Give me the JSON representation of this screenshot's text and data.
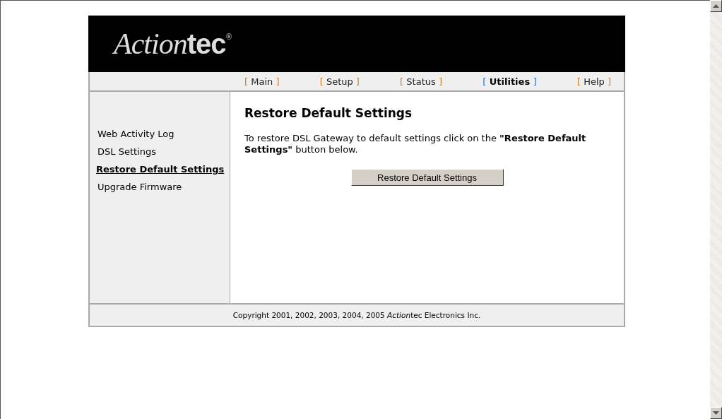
{
  "logo": {
    "script": "Action",
    "bold": "tec",
    "mark": "®"
  },
  "nav": [
    {
      "open": "[",
      "label": "Main",
      "close": "]",
      "selected": false
    },
    {
      "open": "[",
      "label": "Setup",
      "close": "]",
      "selected": false
    },
    {
      "open": "[",
      "label": "Status",
      "close": "]",
      "selected": false
    },
    {
      "open": "[",
      "label": "Utilities",
      "close": "]",
      "selected": true
    },
    {
      "open": "[",
      "label": "Help",
      "close": "]",
      "selected": false
    }
  ],
  "sidebar": {
    "items": [
      {
        "label": "Web Activity Log",
        "selected": false
      },
      {
        "label": "DSL Settings",
        "selected": false
      },
      {
        "label": "Restore Default Settings",
        "selected": true
      },
      {
        "label": "Upgrade Firmware",
        "selected": false
      }
    ]
  },
  "main": {
    "title": "Restore Default Settings",
    "text": "To restore DSL Gateway to default settings click on the **\"Restore Default Settings\"** button below.",
    "button": "Restore Default Settings"
  },
  "footer": {
    "before": "Copyright 2001, 2002, 2003, 2004, 2005",
    "brand_script": "Action",
    "after": "tec Electronics Inc."
  }
}
